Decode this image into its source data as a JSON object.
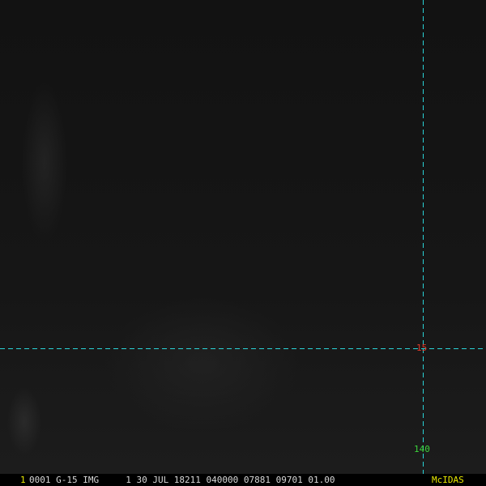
{
  "colors": {
    "background": "#141414",
    "graticule": "#2ad4d8",
    "latitude_label": "#e03a2a",
    "longitude_label": "#3cd43c",
    "status_text": "#d8d8d8",
    "frame_number": "#e8e800",
    "brand": "#e8e800"
  },
  "graticule": {
    "latitude_label": "15",
    "longitude_label": "140"
  },
  "status": {
    "frame_number": "1",
    "line": "0001 G-15 IMG     1 30 JUL 18211 040000 07881 09701 01.00",
    "brand": "McIDAS"
  }
}
